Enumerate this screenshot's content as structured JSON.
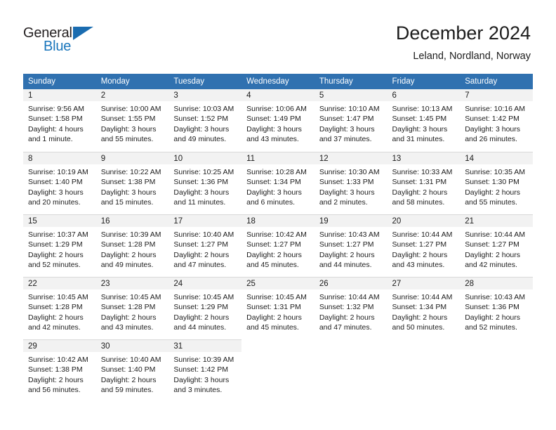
{
  "brand": {
    "name_part1": "General",
    "name_part2": "Blue",
    "flag_icon": "triangle-flag-icon"
  },
  "header": {
    "title": "December 2024",
    "location": "Leland, Nordland, Norway"
  },
  "colors": {
    "header_row": "#3071b0",
    "daynum_bar": "#f2f2f2",
    "brand_blue": "#1a76bc",
    "text": "#1c1c1c",
    "grid_line": "#d9d9d9"
  },
  "weekdays": [
    "Sunday",
    "Monday",
    "Tuesday",
    "Wednesday",
    "Thursday",
    "Friday",
    "Saturday"
  ],
  "weeks": [
    [
      {
        "day": "1",
        "sunrise": "Sunrise: 9:56 AM",
        "sunset": "Sunset: 1:58 PM",
        "daylight1": "Daylight: 4 hours",
        "daylight2": "and 1 minute."
      },
      {
        "day": "2",
        "sunrise": "Sunrise: 10:00 AM",
        "sunset": "Sunset: 1:55 PM",
        "daylight1": "Daylight: 3 hours",
        "daylight2": "and 55 minutes."
      },
      {
        "day": "3",
        "sunrise": "Sunrise: 10:03 AM",
        "sunset": "Sunset: 1:52 PM",
        "daylight1": "Daylight: 3 hours",
        "daylight2": "and 49 minutes."
      },
      {
        "day": "4",
        "sunrise": "Sunrise: 10:06 AM",
        "sunset": "Sunset: 1:49 PM",
        "daylight1": "Daylight: 3 hours",
        "daylight2": "and 43 minutes."
      },
      {
        "day": "5",
        "sunrise": "Sunrise: 10:10 AM",
        "sunset": "Sunset: 1:47 PM",
        "daylight1": "Daylight: 3 hours",
        "daylight2": "and 37 minutes."
      },
      {
        "day": "6",
        "sunrise": "Sunrise: 10:13 AM",
        "sunset": "Sunset: 1:45 PM",
        "daylight1": "Daylight: 3 hours",
        "daylight2": "and 31 minutes."
      },
      {
        "day": "7",
        "sunrise": "Sunrise: 10:16 AM",
        "sunset": "Sunset: 1:42 PM",
        "daylight1": "Daylight: 3 hours",
        "daylight2": "and 26 minutes."
      }
    ],
    [
      {
        "day": "8",
        "sunrise": "Sunrise: 10:19 AM",
        "sunset": "Sunset: 1:40 PM",
        "daylight1": "Daylight: 3 hours",
        "daylight2": "and 20 minutes."
      },
      {
        "day": "9",
        "sunrise": "Sunrise: 10:22 AM",
        "sunset": "Sunset: 1:38 PM",
        "daylight1": "Daylight: 3 hours",
        "daylight2": "and 15 minutes."
      },
      {
        "day": "10",
        "sunrise": "Sunrise: 10:25 AM",
        "sunset": "Sunset: 1:36 PM",
        "daylight1": "Daylight: 3 hours",
        "daylight2": "and 11 minutes."
      },
      {
        "day": "11",
        "sunrise": "Sunrise: 10:28 AM",
        "sunset": "Sunset: 1:34 PM",
        "daylight1": "Daylight: 3 hours",
        "daylight2": "and 6 minutes."
      },
      {
        "day": "12",
        "sunrise": "Sunrise: 10:30 AM",
        "sunset": "Sunset: 1:33 PM",
        "daylight1": "Daylight: 3 hours",
        "daylight2": "and 2 minutes."
      },
      {
        "day": "13",
        "sunrise": "Sunrise: 10:33 AM",
        "sunset": "Sunset: 1:31 PM",
        "daylight1": "Daylight: 2 hours",
        "daylight2": "and 58 minutes."
      },
      {
        "day": "14",
        "sunrise": "Sunrise: 10:35 AM",
        "sunset": "Sunset: 1:30 PM",
        "daylight1": "Daylight: 2 hours",
        "daylight2": "and 55 minutes."
      }
    ],
    [
      {
        "day": "15",
        "sunrise": "Sunrise: 10:37 AM",
        "sunset": "Sunset: 1:29 PM",
        "daylight1": "Daylight: 2 hours",
        "daylight2": "and 52 minutes."
      },
      {
        "day": "16",
        "sunrise": "Sunrise: 10:39 AM",
        "sunset": "Sunset: 1:28 PM",
        "daylight1": "Daylight: 2 hours",
        "daylight2": "and 49 minutes."
      },
      {
        "day": "17",
        "sunrise": "Sunrise: 10:40 AM",
        "sunset": "Sunset: 1:27 PM",
        "daylight1": "Daylight: 2 hours",
        "daylight2": "and 47 minutes."
      },
      {
        "day": "18",
        "sunrise": "Sunrise: 10:42 AM",
        "sunset": "Sunset: 1:27 PM",
        "daylight1": "Daylight: 2 hours",
        "daylight2": "and 45 minutes."
      },
      {
        "day": "19",
        "sunrise": "Sunrise: 10:43 AM",
        "sunset": "Sunset: 1:27 PM",
        "daylight1": "Daylight: 2 hours",
        "daylight2": "and 44 minutes."
      },
      {
        "day": "20",
        "sunrise": "Sunrise: 10:44 AM",
        "sunset": "Sunset: 1:27 PM",
        "daylight1": "Daylight: 2 hours",
        "daylight2": "and 43 minutes."
      },
      {
        "day": "21",
        "sunrise": "Sunrise: 10:44 AM",
        "sunset": "Sunset: 1:27 PM",
        "daylight1": "Daylight: 2 hours",
        "daylight2": "and 42 minutes."
      }
    ],
    [
      {
        "day": "22",
        "sunrise": "Sunrise: 10:45 AM",
        "sunset": "Sunset: 1:28 PM",
        "daylight1": "Daylight: 2 hours",
        "daylight2": "and 42 minutes."
      },
      {
        "day": "23",
        "sunrise": "Sunrise: 10:45 AM",
        "sunset": "Sunset: 1:28 PM",
        "daylight1": "Daylight: 2 hours",
        "daylight2": "and 43 minutes."
      },
      {
        "day": "24",
        "sunrise": "Sunrise: 10:45 AM",
        "sunset": "Sunset: 1:29 PM",
        "daylight1": "Daylight: 2 hours",
        "daylight2": "and 44 minutes."
      },
      {
        "day": "25",
        "sunrise": "Sunrise: 10:45 AM",
        "sunset": "Sunset: 1:31 PM",
        "daylight1": "Daylight: 2 hours",
        "daylight2": "and 45 minutes."
      },
      {
        "day": "26",
        "sunrise": "Sunrise: 10:44 AM",
        "sunset": "Sunset: 1:32 PM",
        "daylight1": "Daylight: 2 hours",
        "daylight2": "and 47 minutes."
      },
      {
        "day": "27",
        "sunrise": "Sunrise: 10:44 AM",
        "sunset": "Sunset: 1:34 PM",
        "daylight1": "Daylight: 2 hours",
        "daylight2": "and 50 minutes."
      },
      {
        "day": "28",
        "sunrise": "Sunrise: 10:43 AM",
        "sunset": "Sunset: 1:36 PM",
        "daylight1": "Daylight: 2 hours",
        "daylight2": "and 52 minutes."
      }
    ],
    [
      {
        "day": "29",
        "sunrise": "Sunrise: 10:42 AM",
        "sunset": "Sunset: 1:38 PM",
        "daylight1": "Daylight: 2 hours",
        "daylight2": "and 56 minutes."
      },
      {
        "day": "30",
        "sunrise": "Sunrise: 10:40 AM",
        "sunset": "Sunset: 1:40 PM",
        "daylight1": "Daylight: 2 hours",
        "daylight2": "and 59 minutes."
      },
      {
        "day": "31",
        "sunrise": "Sunrise: 10:39 AM",
        "sunset": "Sunset: 1:42 PM",
        "daylight1": "Daylight: 3 hours",
        "daylight2": "and 3 minutes."
      },
      {
        "day": "",
        "sunrise": "",
        "sunset": "",
        "daylight1": "",
        "daylight2": ""
      },
      {
        "day": "",
        "sunrise": "",
        "sunset": "",
        "daylight1": "",
        "daylight2": ""
      },
      {
        "day": "",
        "sunrise": "",
        "sunset": "",
        "daylight1": "",
        "daylight2": ""
      },
      {
        "day": "",
        "sunrise": "",
        "sunset": "",
        "daylight1": "",
        "daylight2": ""
      }
    ]
  ]
}
